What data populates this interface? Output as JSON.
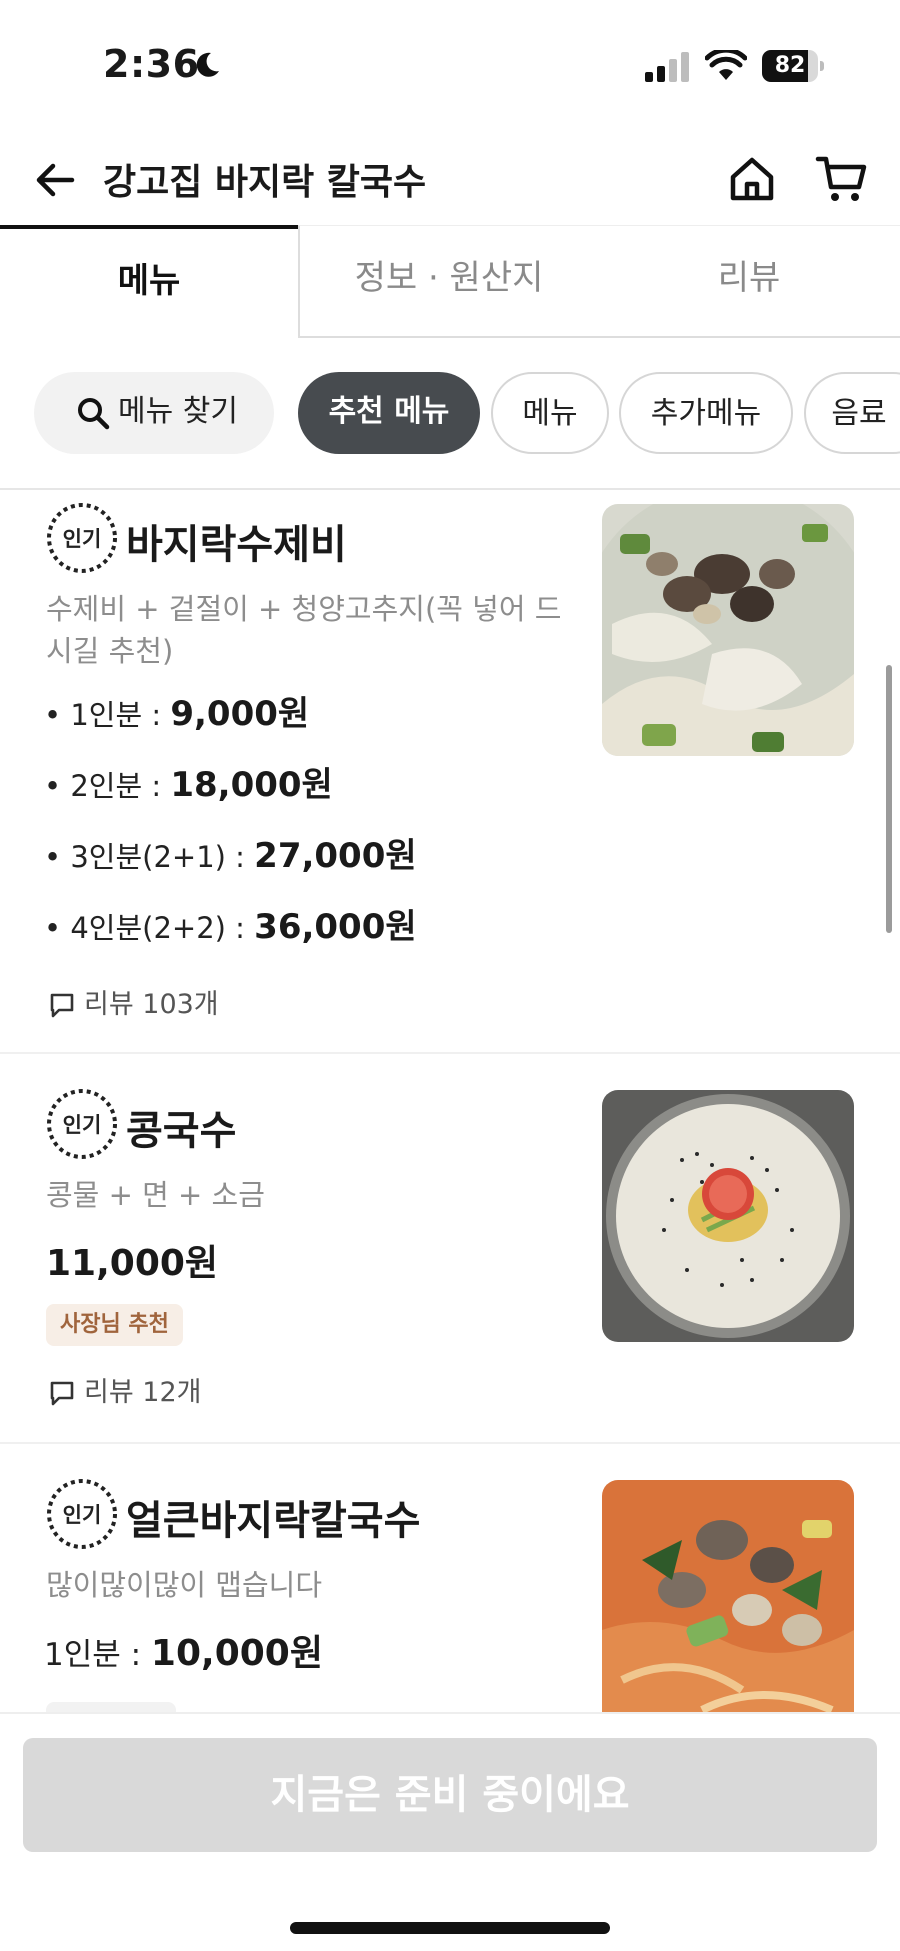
{
  "status_bar": {
    "time": "2:36",
    "battery_level": "82",
    "battery_fraction": 0.82
  },
  "header": {
    "title": "강고집 바지락 칼국수"
  },
  "tabs": [
    {
      "label": "메뉴"
    },
    {
      "label": "정보 · 원산지"
    },
    {
      "label": "리뷰"
    }
  ],
  "chips": {
    "search": "메뉴 찾기",
    "items": [
      "추천 메뉴",
      "메뉴",
      "추가메뉴",
      "음료"
    ]
  },
  "badge_text": "인기",
  "items": [
    {
      "name": "바지락수제비",
      "description": "수제비 + 겉절이 + 청양고추지(꼭 넣어 드시길 추천)",
      "prices": [
        {
          "label": "• 1인분 :",
          "amount": "9,000원"
        },
        {
          "label": "• 2인분 :",
          "amount": "18,000원"
        },
        {
          "label": "• 3인분(2+1) :",
          "amount": "27,000원"
        },
        {
          "label": "• 4인분(2+2) :",
          "amount": "36,000원"
        }
      ],
      "reviews": "리뷰 103개"
    },
    {
      "name": "콩국수",
      "description": "콩물 + 면 + 소금",
      "price": "11,000원",
      "tag": "사장님 추천",
      "reviews": "리뷰 12개"
    },
    {
      "name": "얼큰바지락칼국수",
      "description": "많이많이많이 맵습니다",
      "price_label": "1인분 :",
      "price_amount": "10,000원"
    }
  ],
  "cta": {
    "label": "지금은 준비 중이에요"
  }
}
